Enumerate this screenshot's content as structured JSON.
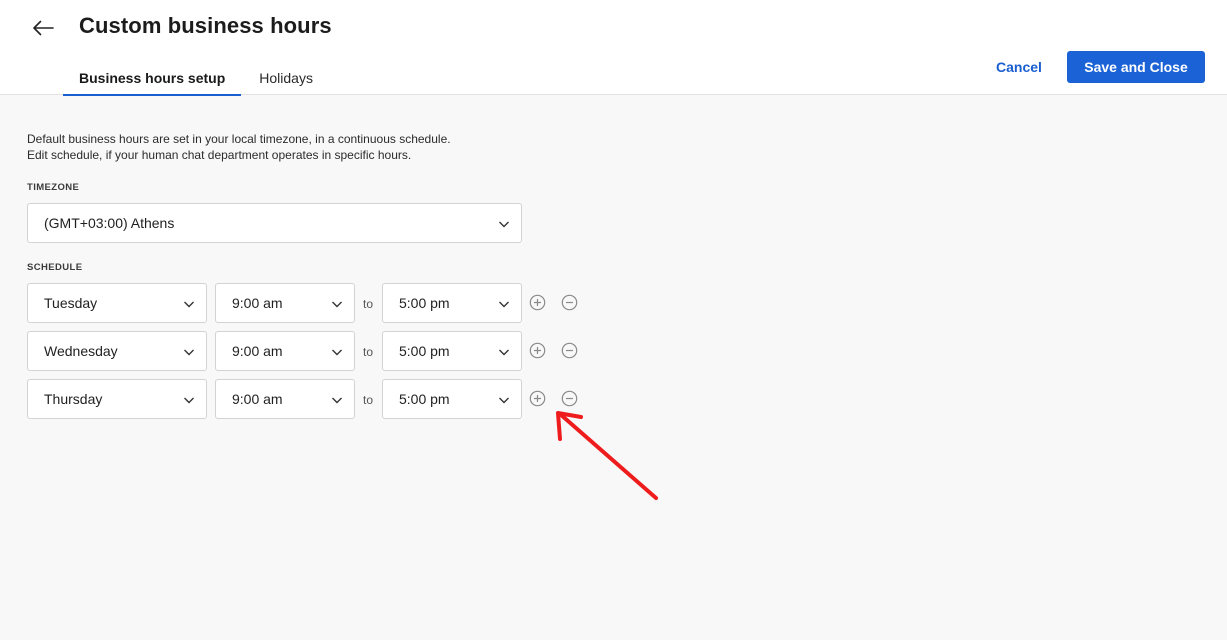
{
  "header": {
    "title": "Custom business hours",
    "back_icon": "arrow-left-icon",
    "tabs": [
      {
        "label": "Business hours setup",
        "active": true
      },
      {
        "label": "Holidays",
        "active": false
      }
    ],
    "cancel_label": "Cancel",
    "save_label": "Save and Close"
  },
  "main": {
    "description_line1": "Default business hours are set in your local timezone, in a continuous schedule.",
    "description_line2": "Edit schedule, if your human chat department operates in specific hours.",
    "timezone_label": "TIMEZONE",
    "timezone_value": "(GMT+03:00) Athens",
    "schedule_label": "SCHEDULE",
    "to_label": "to",
    "schedule": [
      {
        "day": "Tuesday",
        "start": "9:00 am",
        "end": "5:00 pm"
      },
      {
        "day": "Wednesday",
        "start": "9:00 am",
        "end": "5:00 pm"
      },
      {
        "day": "Thursday",
        "start": "9:00 am",
        "end": "5:00 pm"
      }
    ]
  },
  "colors": {
    "accent": "#1a62d6",
    "background": "#f8f8f8",
    "annotation_arrow": "#ee1c1c"
  },
  "icons": {
    "dropdown": "chevron-down-icon",
    "add_row": "plus-circle-icon",
    "remove_row": "minus-circle-icon"
  }
}
